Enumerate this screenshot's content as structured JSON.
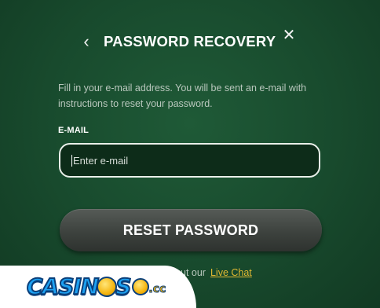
{
  "modal": {
    "back_glyph": "‹",
    "title": "PASSWORD RECOVERY",
    "close_glyph": "✕",
    "description": "Fill in your e-mail address. You will be sent an e-mail with instructions to reset your password.",
    "email": {
      "label": "E-MAIL",
      "placeholder": "Enter e-mail",
      "value": ""
    },
    "reset_button_label": "RESET PASSWORD",
    "support_prefix": "ut our",
    "live_chat_label": "Live Chat"
  },
  "watermark": {
    "brand_part_1": "CASIN",
    "brand_part_2": "S",
    "brand_suffix": ".cc"
  },
  "colors": {
    "background": "#1a4e30",
    "accent_link": "#e0b832",
    "button": "#3d423e",
    "logo_blue": "#1da1f2",
    "logo_navy": "#0a3f7a",
    "logo_gold": "#f5b50f"
  },
  "icons": {
    "back": "chevron-left-icon",
    "close": "close-icon",
    "logo_coin": "coin-icon"
  }
}
